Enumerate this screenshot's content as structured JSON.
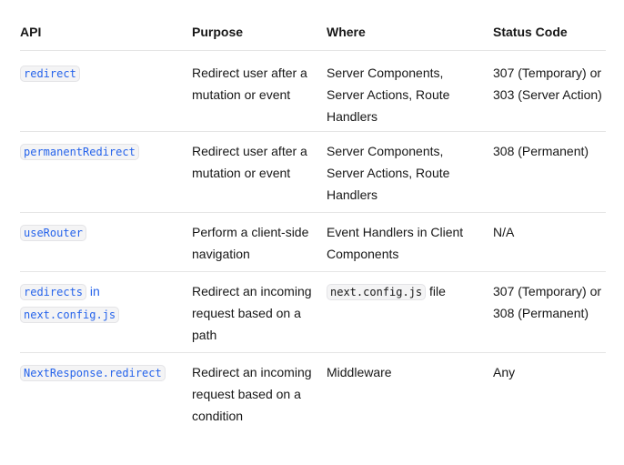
{
  "headers": {
    "api": "API",
    "purpose": "Purpose",
    "where": "Where",
    "status": "Status Code"
  },
  "rows": [
    {
      "api": "redirect",
      "purpose": "Redirect user after a mutation or event",
      "where": "Server Components, Server Actions, Route Handlers",
      "status": "307 (Temporary) or 303 (Server Action)"
    },
    {
      "api": "permanentRedirect",
      "purpose": "Redirect user after a mutation or event",
      "where": "Server Components, Server Actions, Route Handlers",
      "status": "308 (Permanent)"
    },
    {
      "api": "useRouter",
      "purpose": "Perform a client-side navigation",
      "where": "Event Handlers in Client Components",
      "status": "N/A"
    },
    {
      "api": "redirects",
      "api_connector": "in",
      "api_secondary": "next.config.js",
      "purpose": "Redirect an incoming request based on a path",
      "where_code": "next.config.js",
      "where_suffix": "file",
      "status": "307 (Temporary) or 308 (Permanent)"
    },
    {
      "api": "NextResponse.redirect",
      "purpose": "Redirect an incoming request based on a condition",
      "where": "Middleware",
      "status": "Any"
    }
  ]
}
